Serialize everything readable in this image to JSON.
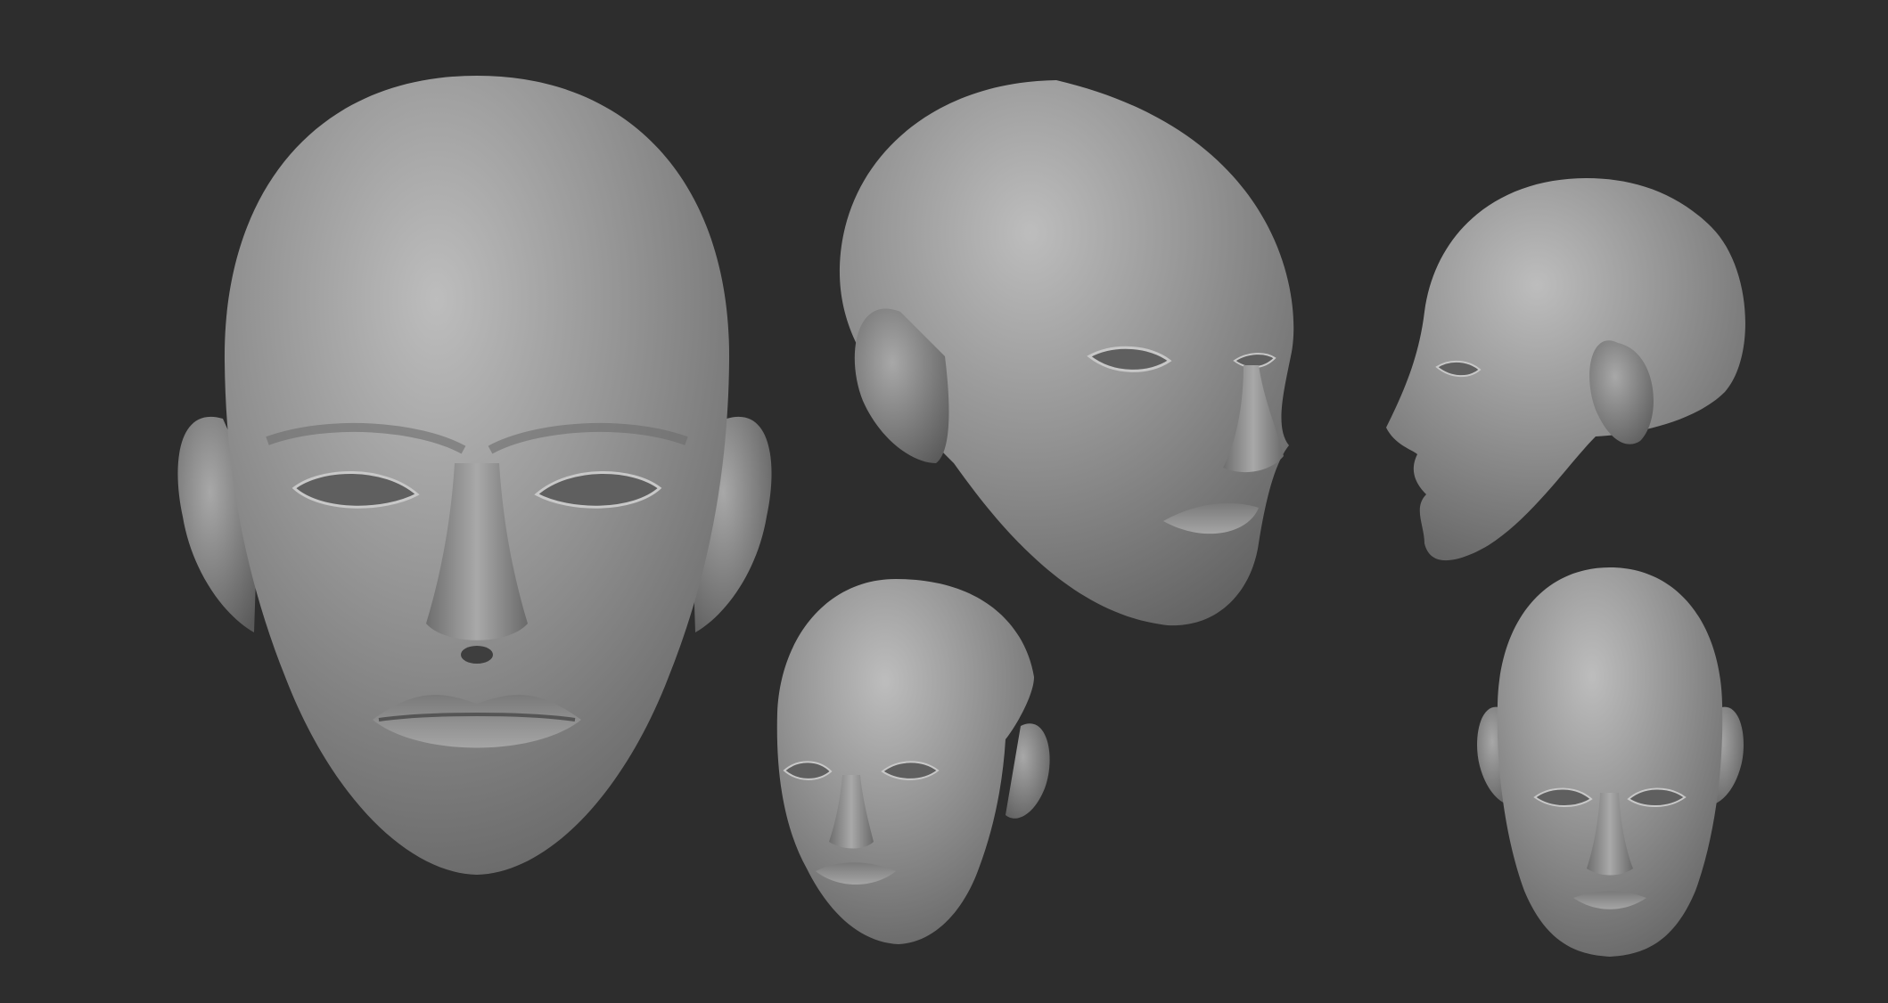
{
  "scene": {
    "background_color": "#2d2d2d",
    "clay_color": "#8c8c8c",
    "views": [
      {
        "name": "front"
      },
      {
        "name": "three-quarter-right"
      },
      {
        "name": "side-profile-left"
      },
      {
        "name": "three-quarter-small"
      },
      {
        "name": "front-small"
      }
    ]
  }
}
